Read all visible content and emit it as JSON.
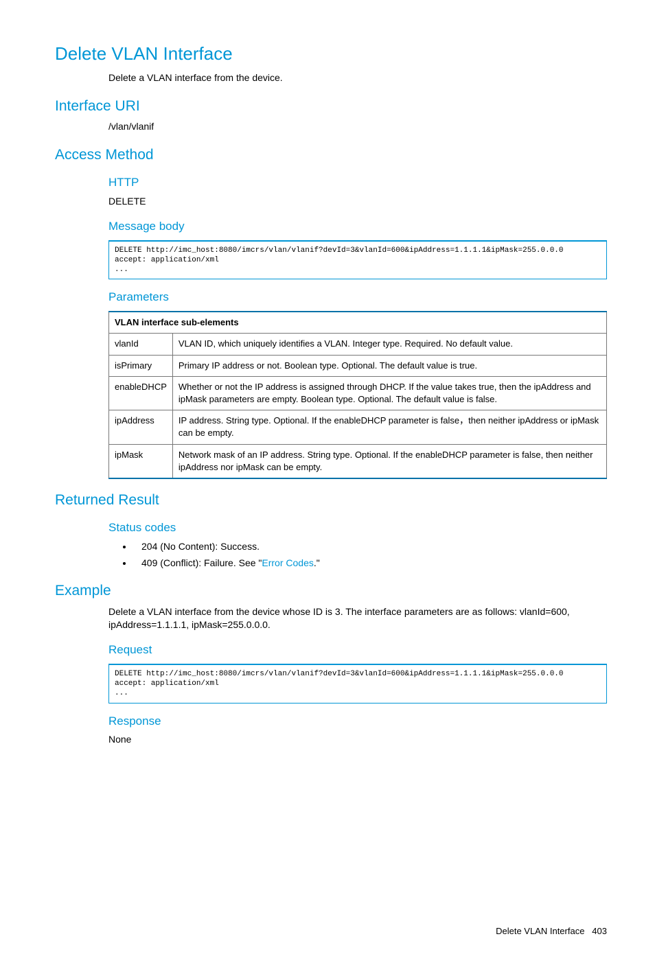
{
  "title": "Delete VLAN Interface",
  "intro": "Delete a VLAN interface from the device.",
  "interface_uri": {
    "heading": "Interface URI",
    "path": "/vlan/vlanif"
  },
  "access_method": {
    "heading": "Access Method",
    "http_heading": "HTTP",
    "http_method": "DELETE",
    "body_heading": "Message body",
    "body_code": "DELETE http://imc_host:8080/imcrs/vlan/vlanif?devId=3&vlanId=600&ipAddress=1.1.1.1&ipMask=255.0.0.0\naccept: application/xml\n...",
    "params_heading": "Parameters",
    "table_header": "VLAN interface sub-elements",
    "params": [
      {
        "name": "vlanId",
        "desc": "VLAN ID, which uniquely identifies a VLAN. Integer type. Required. No default value."
      },
      {
        "name": "isPrimary",
        "desc": "Primary IP address or not. Boolean type. Optional. The default value is true."
      },
      {
        "name": "enableDHCP",
        "desc": "Whether or not the IP address is assigned through DHCP. If the value takes true, then the ipAddress and ipMask parameters are empty. Boolean type. Optional. The default value is false."
      },
      {
        "name": "ipAddress",
        "desc": "IP address. String type. Optional. If the enableDHCP parameter is false，then neither ipAddress or ipMask can be empty."
      },
      {
        "name": "ipMask",
        "desc": "Network mask of an IP address. String type. Optional. If the enableDHCP parameter is false, then neither ipAddress nor ipMask can be empty."
      }
    ]
  },
  "result": {
    "heading": "Returned Result",
    "status_heading": "Status codes",
    "codes": {
      "204": "204 (No Content): Success.",
      "409_pre": "409 (Conflict): Failure. See \"",
      "409_link": "Error Codes",
      "409_post": ".\""
    }
  },
  "example": {
    "heading": "Example",
    "intro": "Delete a VLAN interface from the device whose ID is 3. The interface parameters are as follows: vlanId=600, ipAddress=1.1.1.1, ipMask=255.0.0.0.",
    "request_heading": "Request",
    "request_code": "DELETE http://imc_host:8080/imcrs/vlan/vlanif?devId=3&vlanId=600&ipAddress=1.1.1.1&ipMask=255.0.0.0\naccept: application/xml\n...",
    "response_heading": "Response",
    "response_text": "None"
  },
  "footer": {
    "title": "Delete VLAN Interface",
    "page": "403"
  }
}
